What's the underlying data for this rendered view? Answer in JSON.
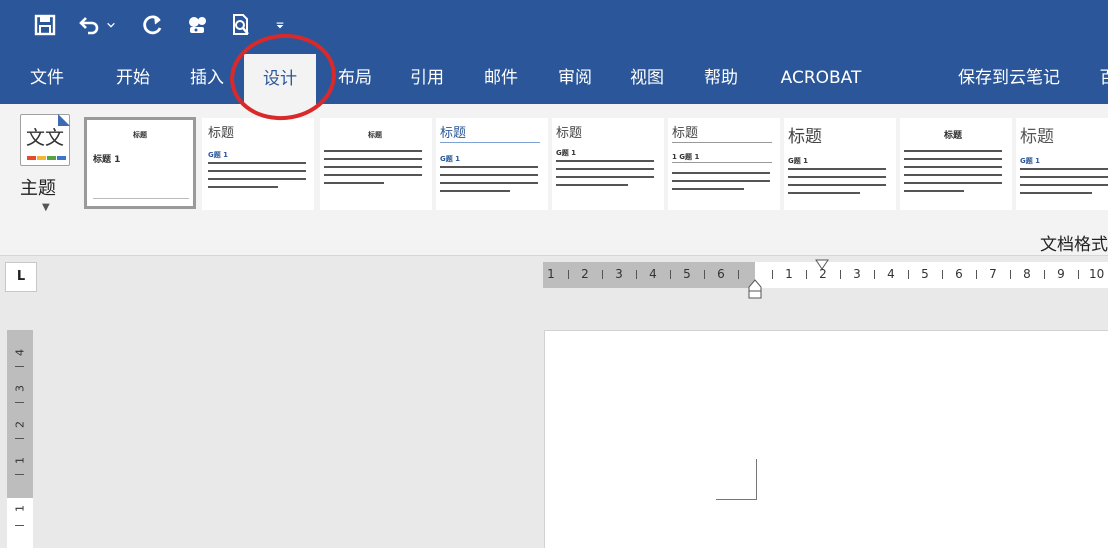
{
  "quick_access": {
    "icons": [
      "save-icon",
      "undo-icon",
      "undo-dropdown-icon",
      "redo-icon",
      "touch-mode-icon",
      "print-preview-icon",
      "customize-qat-icon"
    ]
  },
  "tabs": [
    {
      "label": "文件"
    },
    {
      "label": "开始"
    },
    {
      "label": "插入"
    },
    {
      "label": "设计",
      "active": true
    },
    {
      "label": "布局"
    },
    {
      "label": "引用"
    },
    {
      "label": "邮件"
    },
    {
      "label": "审阅"
    },
    {
      "label": "视图"
    },
    {
      "label": "帮助"
    },
    {
      "label": "ACROBAT"
    },
    {
      "label": "保存到云笔记"
    },
    {
      "label": "百"
    }
  ],
  "ribbon": {
    "theme_label": "主题",
    "group_label": "文档格式",
    "style_set": {
      "card1_heading": "标题",
      "card1_h1": "标题 1",
      "card_heading": "标题",
      "card_h1": "G题 1",
      "card_h1_numbered": "1  G题 1"
    }
  },
  "ruler": {
    "margin_numbers": [
      "6",
      "5",
      "4",
      "3",
      "2",
      "1"
    ],
    "content_numbers": [
      "1",
      "2",
      "3",
      "4",
      "5",
      "6",
      "7",
      "8",
      "9",
      "10"
    ],
    "vertical_numbers": [
      "4",
      "3",
      "2",
      "1",
      "1"
    ]
  },
  "colors": {
    "ribbon_blue": "#2b579a",
    "highlight_ring": "#d82a2a"
  },
  "highlight": {
    "target": "设计",
    "shape": "circle"
  }
}
